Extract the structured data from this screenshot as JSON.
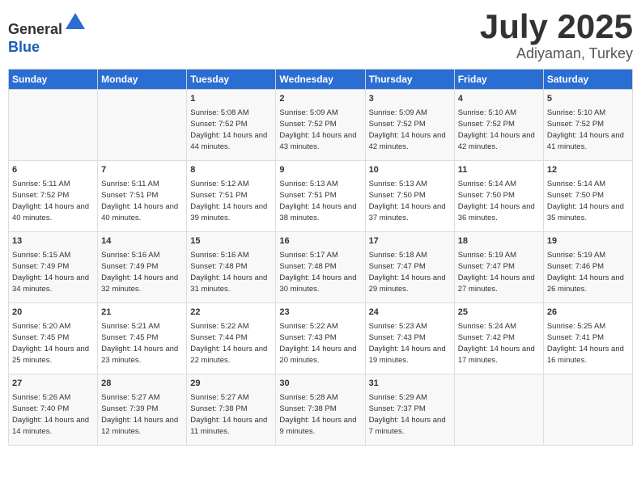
{
  "header": {
    "logo_line1": "General",
    "logo_line2": "Blue",
    "month": "July 2025",
    "location": "Adiyaman, Turkey"
  },
  "weekdays": [
    "Sunday",
    "Monday",
    "Tuesday",
    "Wednesday",
    "Thursday",
    "Friday",
    "Saturday"
  ],
  "weeks": [
    [
      {
        "day": "",
        "info": ""
      },
      {
        "day": "",
        "info": ""
      },
      {
        "day": "1",
        "info": "Sunrise: 5:08 AM\nSunset: 7:52 PM\nDaylight: 14 hours and 44 minutes."
      },
      {
        "day": "2",
        "info": "Sunrise: 5:09 AM\nSunset: 7:52 PM\nDaylight: 14 hours and 43 minutes."
      },
      {
        "day": "3",
        "info": "Sunrise: 5:09 AM\nSunset: 7:52 PM\nDaylight: 14 hours and 42 minutes."
      },
      {
        "day": "4",
        "info": "Sunrise: 5:10 AM\nSunset: 7:52 PM\nDaylight: 14 hours and 42 minutes."
      },
      {
        "day": "5",
        "info": "Sunrise: 5:10 AM\nSunset: 7:52 PM\nDaylight: 14 hours and 41 minutes."
      }
    ],
    [
      {
        "day": "6",
        "info": "Sunrise: 5:11 AM\nSunset: 7:52 PM\nDaylight: 14 hours and 40 minutes."
      },
      {
        "day": "7",
        "info": "Sunrise: 5:11 AM\nSunset: 7:51 PM\nDaylight: 14 hours and 40 minutes."
      },
      {
        "day": "8",
        "info": "Sunrise: 5:12 AM\nSunset: 7:51 PM\nDaylight: 14 hours and 39 minutes."
      },
      {
        "day": "9",
        "info": "Sunrise: 5:13 AM\nSunset: 7:51 PM\nDaylight: 14 hours and 38 minutes."
      },
      {
        "day": "10",
        "info": "Sunrise: 5:13 AM\nSunset: 7:50 PM\nDaylight: 14 hours and 37 minutes."
      },
      {
        "day": "11",
        "info": "Sunrise: 5:14 AM\nSunset: 7:50 PM\nDaylight: 14 hours and 36 minutes."
      },
      {
        "day": "12",
        "info": "Sunrise: 5:14 AM\nSunset: 7:50 PM\nDaylight: 14 hours and 35 minutes."
      }
    ],
    [
      {
        "day": "13",
        "info": "Sunrise: 5:15 AM\nSunset: 7:49 PM\nDaylight: 14 hours and 34 minutes."
      },
      {
        "day": "14",
        "info": "Sunrise: 5:16 AM\nSunset: 7:49 PM\nDaylight: 14 hours and 32 minutes."
      },
      {
        "day": "15",
        "info": "Sunrise: 5:16 AM\nSunset: 7:48 PM\nDaylight: 14 hours and 31 minutes."
      },
      {
        "day": "16",
        "info": "Sunrise: 5:17 AM\nSunset: 7:48 PM\nDaylight: 14 hours and 30 minutes."
      },
      {
        "day": "17",
        "info": "Sunrise: 5:18 AM\nSunset: 7:47 PM\nDaylight: 14 hours and 29 minutes."
      },
      {
        "day": "18",
        "info": "Sunrise: 5:19 AM\nSunset: 7:47 PM\nDaylight: 14 hours and 27 minutes."
      },
      {
        "day": "19",
        "info": "Sunrise: 5:19 AM\nSunset: 7:46 PM\nDaylight: 14 hours and 26 minutes."
      }
    ],
    [
      {
        "day": "20",
        "info": "Sunrise: 5:20 AM\nSunset: 7:45 PM\nDaylight: 14 hours and 25 minutes."
      },
      {
        "day": "21",
        "info": "Sunrise: 5:21 AM\nSunset: 7:45 PM\nDaylight: 14 hours and 23 minutes."
      },
      {
        "day": "22",
        "info": "Sunrise: 5:22 AM\nSunset: 7:44 PM\nDaylight: 14 hours and 22 minutes."
      },
      {
        "day": "23",
        "info": "Sunrise: 5:22 AM\nSunset: 7:43 PM\nDaylight: 14 hours and 20 minutes."
      },
      {
        "day": "24",
        "info": "Sunrise: 5:23 AM\nSunset: 7:43 PM\nDaylight: 14 hours and 19 minutes."
      },
      {
        "day": "25",
        "info": "Sunrise: 5:24 AM\nSunset: 7:42 PM\nDaylight: 14 hours and 17 minutes."
      },
      {
        "day": "26",
        "info": "Sunrise: 5:25 AM\nSunset: 7:41 PM\nDaylight: 14 hours and 16 minutes."
      }
    ],
    [
      {
        "day": "27",
        "info": "Sunrise: 5:26 AM\nSunset: 7:40 PM\nDaylight: 14 hours and 14 minutes."
      },
      {
        "day": "28",
        "info": "Sunrise: 5:27 AM\nSunset: 7:39 PM\nDaylight: 14 hours and 12 minutes."
      },
      {
        "day": "29",
        "info": "Sunrise: 5:27 AM\nSunset: 7:38 PM\nDaylight: 14 hours and 11 minutes."
      },
      {
        "day": "30",
        "info": "Sunrise: 5:28 AM\nSunset: 7:38 PM\nDaylight: 14 hours and 9 minutes."
      },
      {
        "day": "31",
        "info": "Sunrise: 5:29 AM\nSunset: 7:37 PM\nDaylight: 14 hours and 7 minutes."
      },
      {
        "day": "",
        "info": ""
      },
      {
        "day": "",
        "info": ""
      }
    ]
  ]
}
